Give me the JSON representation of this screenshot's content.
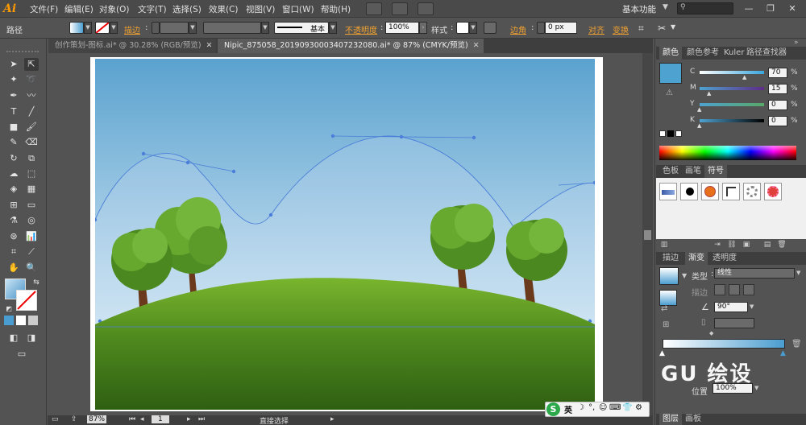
{
  "app": {
    "logo": "Ai"
  },
  "menu": [
    {
      "label": "文件(F)"
    },
    {
      "label": "编辑(E)"
    },
    {
      "label": "对象(O)"
    },
    {
      "label": "文字(T)"
    },
    {
      "label": "选择(S)"
    },
    {
      "label": "效果(C)"
    },
    {
      "label": "视图(V)"
    },
    {
      "label": "窗口(W)"
    },
    {
      "label": "帮助(H)"
    }
  ],
  "workspace": {
    "label": "基本功能"
  },
  "window_controls": {
    "minimize": "—",
    "restore": "❐",
    "close": "✕"
  },
  "control_bar": {
    "object_type": "路径",
    "stroke_label": "描边",
    "brush_label": "基本",
    "opacity_label": "不透明度",
    "opacity_value": "100%",
    "style_label": "样式",
    "corner_label": "边角",
    "corner_value": "0 px",
    "align_label": "对齐",
    "transform_label": "变换"
  },
  "tabs": [
    {
      "title": "创作策划-图标.ai* @ 30.28% (RGB/预览)",
      "close": "✕"
    },
    {
      "title": "Nipic_875058_20190930003407232080.ai* @ 87% (CMYK/预览)",
      "close": "✕"
    }
  ],
  "status_bar": {
    "zoom": "87%",
    "page": "1",
    "tool_name": "直接选择"
  },
  "ime": {
    "logo": "S",
    "lang": "英",
    "items": [
      "☽",
      "°,",
      "☺",
      "⌨",
      "👕",
      "⚙"
    ]
  },
  "color_panel": {
    "tabs": [
      "颜色",
      "颜色参考",
      "Kuler",
      "路径查找器"
    ],
    "swatch_color": "#4ea2d0",
    "channels": [
      {
        "label": "C",
        "value": "70",
        "pct": 0.7,
        "track": "linear-gradient(90deg,#ffffff,#3aa6de)"
      },
      {
        "label": "M",
        "value": "15",
        "pct": 0.15,
        "track": "linear-gradient(90deg,#4ea2d0,#5e2b88)"
      },
      {
        "label": "Y",
        "value": "0",
        "pct": 0.0,
        "track": "linear-gradient(90deg,#4ea2d0,#58a868)"
      },
      {
        "label": "K",
        "value": "0",
        "pct": 0.0,
        "track": "linear-gradient(90deg,#4ea2d0,#000000)"
      }
    ],
    "unit": "%"
  },
  "swatch_panel": {
    "tabs": [
      "色板",
      "画笔",
      "符号"
    ]
  },
  "gradient_panel": {
    "tabs": [
      "描边",
      "渐变",
      "透明度"
    ],
    "type_label": "类型",
    "type_value": "线性",
    "stroke_label": "描边",
    "angle_value": "90°",
    "location_label": "位置",
    "location_value": "100%",
    "start_color": "#ffffff",
    "end_color": "#4a9dd0"
  },
  "bottom_tabs": [
    "图层",
    "画板"
  ],
  "watermark": "GU 绘设"
}
